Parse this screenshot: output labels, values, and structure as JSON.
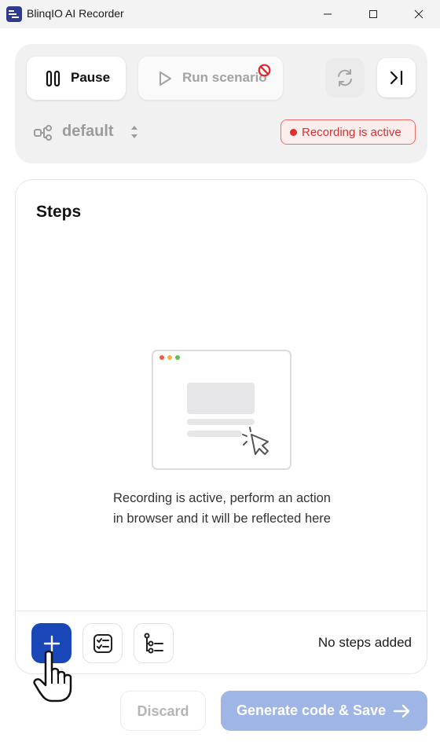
{
  "window": {
    "title": "BlinqIO AI Recorder",
    "controls": [
      "minimize",
      "maximize",
      "close"
    ]
  },
  "toolbar": {
    "pause_label": "Pause",
    "run_label": "Run scenario",
    "run_disabled": true,
    "refresh_icon": "refresh-icon",
    "skip_icon": "skip-to-end-icon"
  },
  "workspace": {
    "selected": "default"
  },
  "status": {
    "label": "Recording is active",
    "color": "#e52b2b"
  },
  "steps": {
    "title": "Steps",
    "empty_line1": "Recording is active, perform an action",
    "empty_line2": "in browser and it will be reflected here",
    "count_label": "No steps added"
  },
  "actions": {
    "discard_label": "Discard",
    "generate_label": "Generate code & Save"
  },
  "colors": {
    "accent": "#1a47b8",
    "accent_disabled": "#9fb5e6",
    "recording": "#d63232"
  }
}
